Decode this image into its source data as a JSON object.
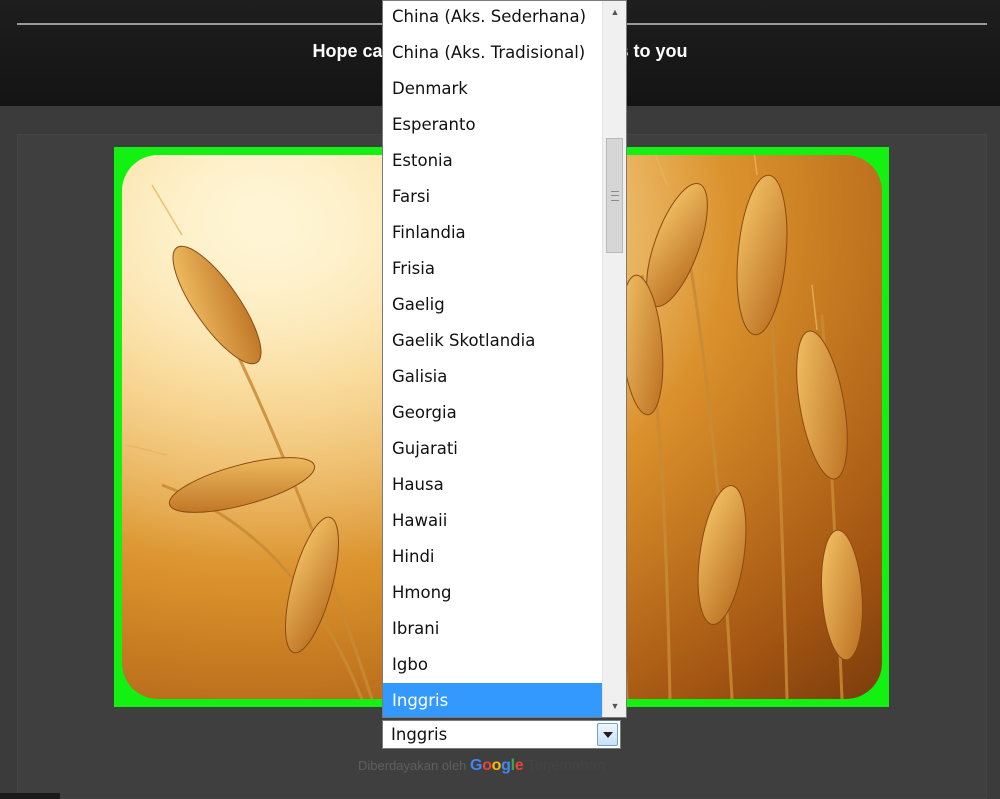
{
  "header": {
    "message_left": "Hope ca",
    "message_right": "ts to you"
  },
  "translate": {
    "selected_language": "Inggris",
    "options": [
      "China (Aks. Sederhana)",
      "China (Aks. Tradisional)",
      "Denmark",
      "Esperanto",
      "Estonia",
      "Farsi",
      "Finlandia",
      "Frisia",
      "Gaelig",
      "Gaelik Skotlandia",
      "Galisia",
      "Georgia",
      "Gujarati",
      "Hausa",
      "Hawaii",
      "Hindi",
      "Hmong",
      "Ibrani",
      "Igbo",
      "Inggris"
    ],
    "powered_prefix": "Diberdayakan oleh",
    "google_letters": [
      "G",
      "o",
      "o",
      "g",
      "l",
      "e"
    ],
    "translate_link": "Terjemahan",
    "scroll_up_glyph": "▲",
    "scroll_down_glyph": "▼"
  },
  "colors": {
    "frame": "#13f113",
    "selected_option": "#3399ff",
    "google_letters": [
      "#4285f4",
      "#ea4335",
      "#fbbc05",
      "#4285f4",
      "#34a853",
      "#ea4335"
    ]
  },
  "image": {
    "subject": "wheat-field-photo"
  }
}
